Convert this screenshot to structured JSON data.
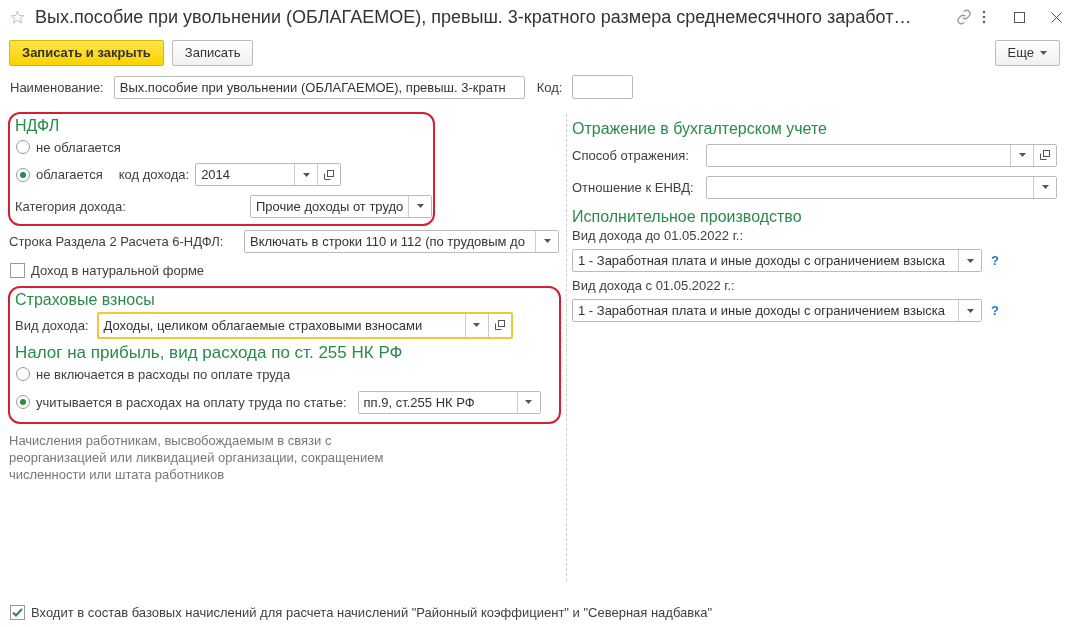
{
  "window": {
    "title": "Вых.пособие при увольнении (ОБЛАГАЕМОЕ), превыш. 3-кратного размера среднемесячного заработ…",
    "favorite": false
  },
  "toolbar": {
    "buttons": [
      {
        "label": "Записать и закрыть",
        "kind": "primary"
      },
      {
        "label": "Записать",
        "kind": "default"
      }
    ],
    "more": "Еще"
  },
  "name_row": {
    "label": "Наименование:",
    "value": "Вых.пособие при увольнении (ОБЛАГАЕМОЕ), превыш. 3-кратн",
    "code_label": "Код:"
  },
  "ndfl": {
    "title": "НДФЛ",
    "highlighted": true,
    "options": [
      {
        "label": "не облагается",
        "selected": false
      },
      {
        "label": "облагается",
        "selected": true
      }
    ],
    "income_code": {
      "label": "код дохода:",
      "value": "2014"
    },
    "category": {
      "label": "Категория дохода:",
      "value": "Прочие доходы от трудо"
    }
  },
  "line_6ndfl": {
    "label": "Строка Раздела 2 Расчета 6-НДФЛ:",
    "value": "Включать в строки 110 и 112 (по трудовым до"
  },
  "natural": {
    "label": "Доход в натуральной форме",
    "checked": false
  },
  "insurance": {
    "title": "Страховые взносы",
    "highlighted": true,
    "income_type": {
      "label": "Вид дохода:",
      "value": "Доходы, целиком облагаемые страховыми взносами",
      "focused": true
    },
    "profit_title": "Налог на прибыль, вид расхода по ст. 255 НК РФ",
    "options": [
      {
        "label": "не включается в расходы по оплате труда",
        "selected": false
      },
      {
        "label": "учитывается в расходах на оплату труда по статье:",
        "selected": true
      }
    ],
    "article": "пп.9, ст.255 НК РФ"
  },
  "note": "Начисления работникам, высвобождаемым в связи с реорганизацией или ликвидацией организации, сокращением численности или штата работников",
  "accounting": {
    "title": "Отражение в бухгалтерском учете",
    "fields": [
      {
        "label": "Способ отражения:",
        "open_button": true
      },
      {
        "label": "Отношение к ЕНВД:",
        "open_button": false
      }
    ]
  },
  "enforcement": {
    "title": "Исполнительное производство",
    "fields": [
      {
        "label": "Вид дохода до 01.05.2022 г.:",
        "value": "1 - Заработная плата и иные доходы с ограничением взыска",
        "help": "?"
      },
      {
        "label": "Вид дохода с 01.05.2022 г.:",
        "value": "1 - Заработная плата и иные доходы с ограничением взыска",
        "help": "?"
      }
    ]
  },
  "footer": {
    "label": "Входит в состав базовых начислений для расчета начислений \"Районный коэффициент\" и \"Северная надбавка\"",
    "checked": true
  }
}
